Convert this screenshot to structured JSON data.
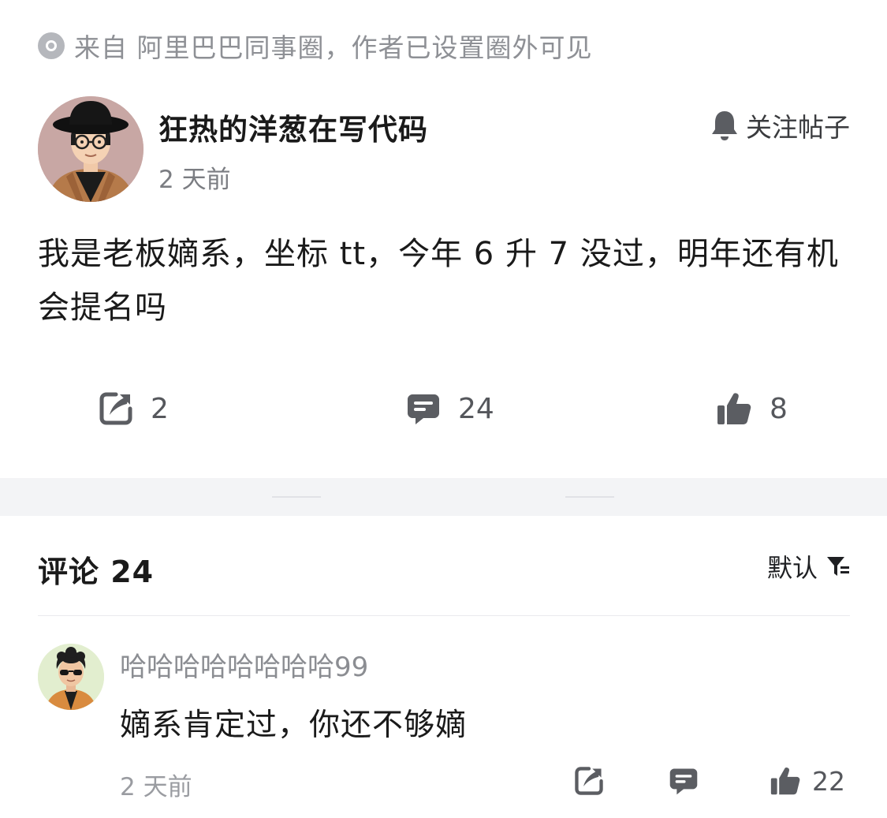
{
  "source": {
    "text": "来自 阿里巴巴同事圈，作者已设置圈外可见",
    "icon": "circle-dot-icon"
  },
  "post": {
    "author": "狂热的洋葱在写代码",
    "time": "2 天前",
    "follow_label": "关注帖子",
    "body": "我是老板嫡系，坐标 tt，今年 6 升 7 没过，明年还有机会提名吗",
    "share_count": "2",
    "comment_count": "24",
    "like_count": "8"
  },
  "comments_section": {
    "title": "评论 24",
    "sort_label": "默认"
  },
  "comments": [
    {
      "author": "哈哈哈哈哈哈哈哈99",
      "text": "嫡系肯定过，你还不够嫡",
      "time": "2 天前",
      "like_count": "22"
    }
  ],
  "colors": {
    "icon_gray": "#5b5d62",
    "muted_text": "#8e9095",
    "divider": "#f3f4f6"
  }
}
